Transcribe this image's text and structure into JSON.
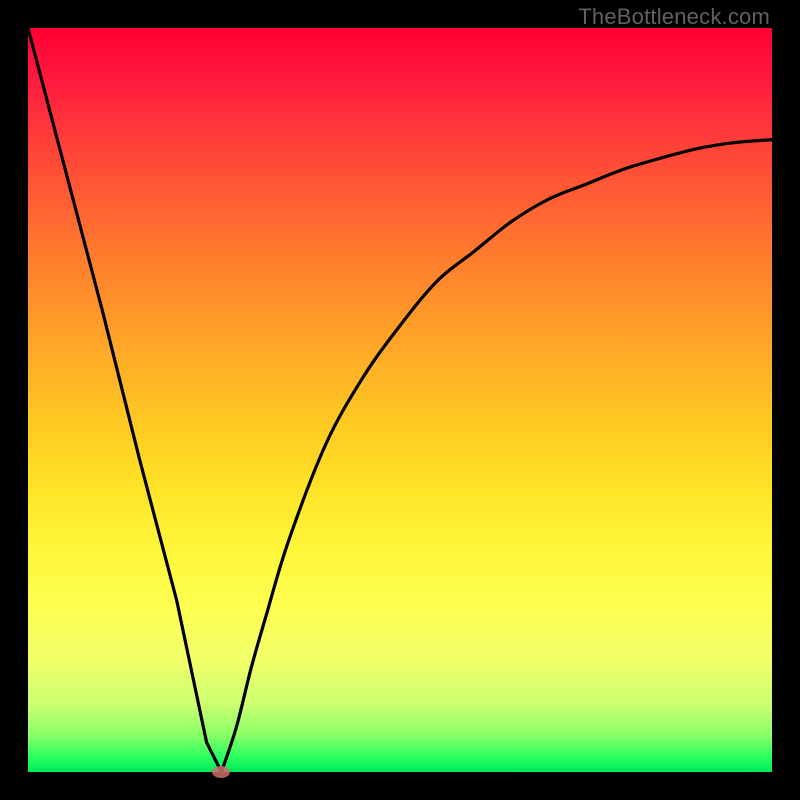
{
  "watermark": "TheBottleneck.com",
  "colors": {
    "background": "#000000",
    "curve": "#000000",
    "dot": "#c9716f"
  },
  "chart_data": {
    "type": "line",
    "title": "",
    "xlabel": "",
    "ylabel": "",
    "xlim": [
      0,
      100
    ],
    "ylim": [
      0,
      100
    ],
    "grid": false,
    "legend": false,
    "series": [
      {
        "name": "left-branch",
        "x": [
          0,
          5,
          10,
          15,
          20,
          24,
          26
        ],
        "values": [
          100,
          81,
          62,
          42,
          23,
          4,
          0
        ]
      },
      {
        "name": "right-branch",
        "x": [
          26,
          28,
          30,
          32,
          35,
          40,
          45,
          50,
          55,
          60,
          65,
          70,
          75,
          80,
          85,
          90,
          95,
          100
        ],
        "values": [
          0,
          6,
          14,
          21,
          31,
          44,
          53,
          60,
          66,
          70,
          74,
          77,
          79,
          81,
          82.5,
          83.8,
          84.6,
          85
        ]
      }
    ],
    "points": [
      {
        "name": "min-dot",
        "x": 26,
        "y": 0
      }
    ]
  }
}
